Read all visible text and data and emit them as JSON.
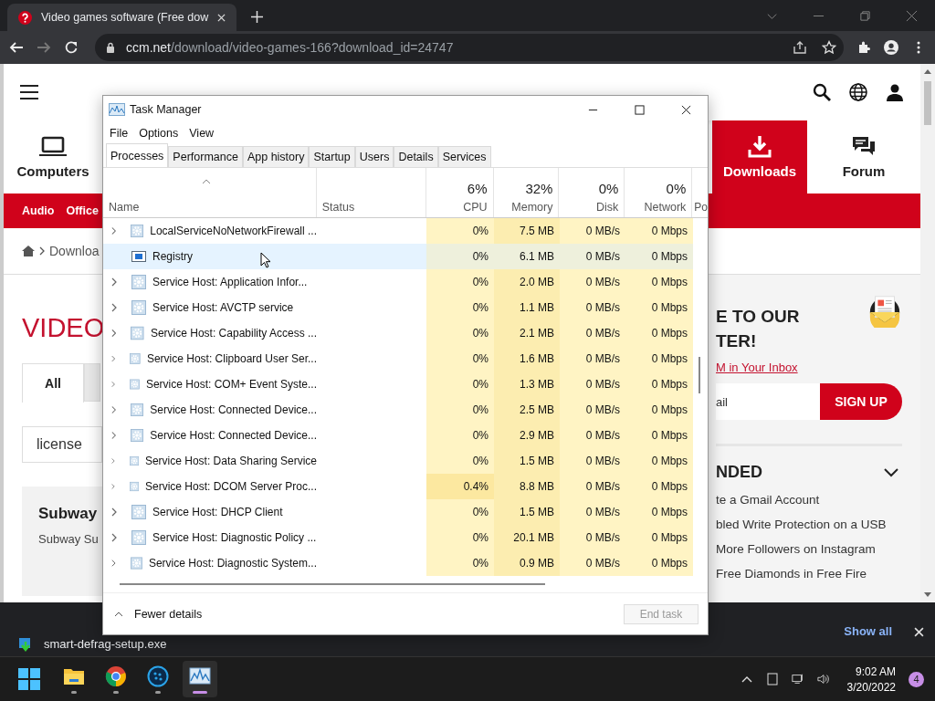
{
  "browser": {
    "tab_title": "Video games software (Free dow",
    "url_host": "ccm.net",
    "url_path": "/download/video-games-166?download_id=24747"
  },
  "site": {
    "nav": [
      {
        "label": "Computers",
        "kind": "laptop",
        "selected": false
      },
      {
        "label": "Downloads",
        "kind": "download",
        "selected": true
      },
      {
        "label": "Forum",
        "kind": "forum",
        "selected": false
      }
    ],
    "subnav": [
      "Audio",
      "Office"
    ],
    "breadcrumb": "Downloa",
    "heading": "VIDEO",
    "filter_tabs": [
      {
        "label": "All",
        "selected": true
      }
    ],
    "search_value": "license",
    "card": {
      "title": "Subway",
      "text": "Subway Su"
    },
    "newsletter": {
      "title_lines": [
        "E TO OUR",
        "TER!"
      ],
      "link": "M in Your Inbox",
      "placeholder": "ail",
      "button": "SIGN UP"
    },
    "recommended": {
      "title": "NDED",
      "items": [
        "te a Gmail Account",
        "bled Write Protection on a USB",
        "More Followers on Instagram",
        "Free Diamonds in Free Fire"
      ]
    }
  },
  "task_manager": {
    "title": "Task Manager",
    "menu": [
      "File",
      "Options",
      "View"
    ],
    "tabs": [
      {
        "label": "Processes",
        "selected": true
      },
      {
        "label": "Performance",
        "selected": false
      },
      {
        "label": "App history",
        "selected": false
      },
      {
        "label": "Startup",
        "selected": false
      },
      {
        "label": "Users",
        "selected": false
      },
      {
        "label": "Details",
        "selected": false
      },
      {
        "label": "Services",
        "selected": false
      }
    ],
    "columns": [
      {
        "label": "Name"
      },
      {
        "label": "Status"
      },
      {
        "label": "CPU",
        "total": "6%"
      },
      {
        "label": "Memory",
        "total": "32%"
      },
      {
        "label": "Disk",
        "total": "0%"
      },
      {
        "label": "Network",
        "total": "0%"
      },
      {
        "label": "Po"
      }
    ],
    "rows": [
      {
        "name": "LocalServiceNoNetworkFirewall ...",
        "kind": "service",
        "expandable": true,
        "selected": false,
        "cpu_busy": false,
        "cpu": "0%",
        "memory": "7.5 MB",
        "disk": "0 MB/s",
        "network": "0 Mbps"
      },
      {
        "name": "Registry",
        "kind": "registry",
        "expandable": false,
        "selected": true,
        "cpu_busy": false,
        "cpu": "0%",
        "memory": "6.1 MB",
        "disk": "0 MB/s",
        "network": "0 Mbps"
      },
      {
        "name": "Service Host: Application Infor...",
        "kind": "service",
        "expandable": true,
        "selected": false,
        "cpu_busy": false,
        "cpu": "0%",
        "memory": "2.0 MB",
        "disk": "0 MB/s",
        "network": "0 Mbps"
      },
      {
        "name": "Service Host: AVCTP service",
        "kind": "service",
        "expandable": true,
        "selected": false,
        "cpu_busy": false,
        "cpu": "0%",
        "memory": "1.1 MB",
        "disk": "0 MB/s",
        "network": "0 Mbps"
      },
      {
        "name": "Service Host: Capability Access ...",
        "kind": "service",
        "expandable": true,
        "selected": false,
        "cpu_busy": false,
        "cpu": "0%",
        "memory": "2.1 MB",
        "disk": "0 MB/s",
        "network": "0 Mbps"
      },
      {
        "name": "Service Host: Clipboard User Ser...",
        "kind": "service",
        "expandable": true,
        "selected": false,
        "cpu_busy": false,
        "cpu": "0%",
        "memory": "1.6 MB",
        "disk": "0 MB/s",
        "network": "0 Mbps"
      },
      {
        "name": "Service Host: COM+ Event Syste...",
        "kind": "service",
        "expandable": true,
        "selected": false,
        "cpu_busy": false,
        "cpu": "0%",
        "memory": "1.3 MB",
        "disk": "0 MB/s",
        "network": "0 Mbps"
      },
      {
        "name": "Service Host: Connected Device...",
        "kind": "service",
        "expandable": true,
        "selected": false,
        "cpu_busy": false,
        "cpu": "0%",
        "memory": "2.5 MB",
        "disk": "0 MB/s",
        "network": "0 Mbps"
      },
      {
        "name": "Service Host: Connected Device...",
        "kind": "service",
        "expandable": true,
        "selected": false,
        "cpu_busy": false,
        "cpu": "0%",
        "memory": "2.9 MB",
        "disk": "0 MB/s",
        "network": "0 Mbps"
      },
      {
        "name": "Service Host: Data Sharing Service",
        "kind": "service",
        "expandable": true,
        "selected": false,
        "cpu_busy": false,
        "cpu": "0%",
        "memory": "1.5 MB",
        "disk": "0 MB/s",
        "network": "0 Mbps"
      },
      {
        "name": "Service Host: DCOM Server Proc...",
        "kind": "service",
        "expandable": true,
        "selected": false,
        "cpu_busy": true,
        "cpu": "0.4%",
        "memory": "8.8 MB",
        "disk": "0 MB/s",
        "network": "0 Mbps"
      },
      {
        "name": "Service Host: DHCP Client",
        "kind": "service",
        "expandable": true,
        "selected": false,
        "cpu_busy": false,
        "cpu": "0%",
        "memory": "1.5 MB",
        "disk": "0 MB/s",
        "network": "0 Mbps"
      },
      {
        "name": "Service Host: Diagnostic Policy ...",
        "kind": "service",
        "expandable": true,
        "selected": false,
        "cpu_busy": false,
        "cpu": "0%",
        "memory": "20.1 MB",
        "disk": "0 MB/s",
        "network": "0 Mbps"
      },
      {
        "name": "Service Host: Diagnostic System...",
        "kind": "service",
        "expandable": true,
        "selected": false,
        "cpu_busy": false,
        "cpu": "0%",
        "memory": "0.9 MB",
        "disk": "0 MB/s",
        "network": "0 Mbps"
      }
    ],
    "fewer_details": "Fewer details",
    "end_task": {
      "label": "End task",
      "disabled": true
    }
  },
  "download_bar": {
    "file": "smart-defrag-setup.exe",
    "show_all": "Show all"
  },
  "taskbar": {
    "apps": [
      {
        "kind": "files",
        "selected": false
      },
      {
        "kind": "browser",
        "selected": false
      },
      {
        "kind": "defrag",
        "selected": false
      },
      {
        "kind": "monitor",
        "selected": true
      }
    ],
    "time": "9:02 AM",
    "date": "3/20/2022",
    "badge": "4"
  }
}
